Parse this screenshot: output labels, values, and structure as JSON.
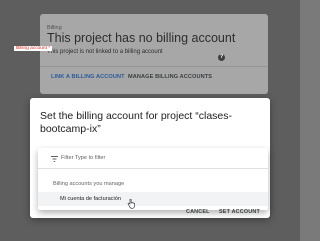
{
  "billing_card": {
    "heading": "Billing",
    "title": "This project has no billing account",
    "description": "This project is not linked to a billing account",
    "link_label": "LINK A BILLING ACCOUNT",
    "manage_label": "MANAGE BILLING ACCOUNTS"
  },
  "dialog": {
    "title": "Set the billing account for project “clases-bootcamp-ix”",
    "field_label": "Billing account *",
    "help_icon": "help-circle-icon",
    "filter_icon": "filter-list-icon",
    "filter_placeholder": "Filter Type to filter",
    "group_label": "Billing accounts you manage",
    "options": [
      {
        "label": "Mi cuenta de facturación"
      }
    ],
    "cancel_label": "CANCEL",
    "set_label": "SET ACCOUNT"
  },
  "colors": {
    "accent": "#1a73e8",
    "error": "#d93025"
  }
}
